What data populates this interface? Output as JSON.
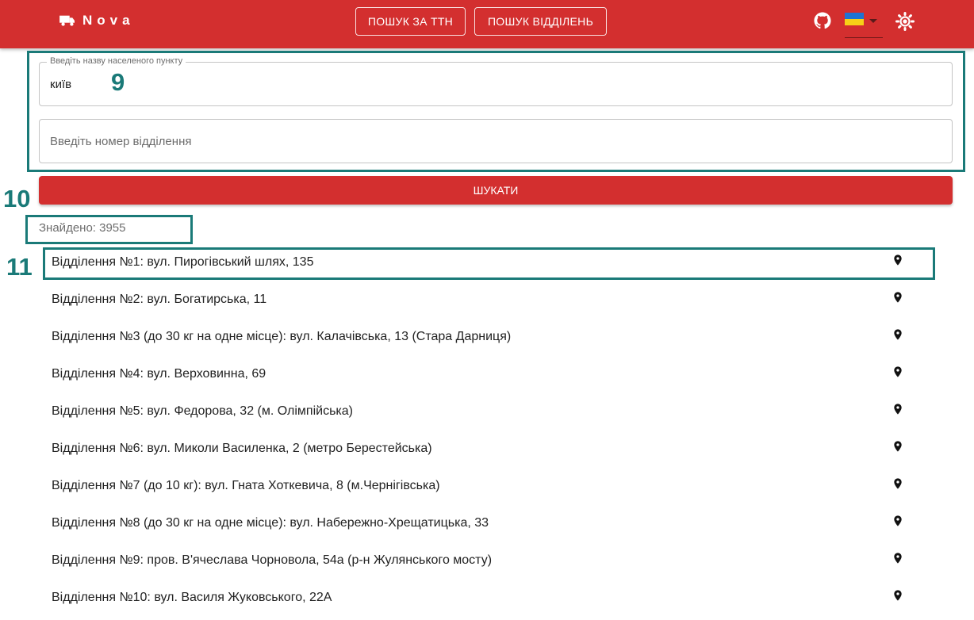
{
  "header": {
    "brand": "Nova",
    "nav": [
      "Пошук за ТТН",
      "Пошук відділень"
    ]
  },
  "annotations": {
    "form": "9",
    "search": "10",
    "first_result": "11"
  },
  "form": {
    "city": {
      "label": "Введіть назву населеного пункту",
      "value": "київ"
    },
    "branch": {
      "placeholder": "Введіть номер відділення"
    },
    "search_label": "Шукати"
  },
  "results": {
    "found_label": "Знайдено: 3955",
    "items": [
      "Відділення №1: вул. Пирогівський шлях, 135",
      "Відділення №2: вул. Богатирська, 11",
      "Відділення №3 (до 30 кг на одне місце): вул. Калачівська, 13 (Стара Дарниця)",
      "Відділення №4: вул. Верховинна, 69",
      "Відділення №5: вул. Федорова, 32 (м. Олімпійська)",
      "Відділення №6: вул. Миколи Василенка, 2 (метро Берестейська)",
      "Відділення №7 (до 10 кг): вул. Гната Хоткевича, 8 (м.Чернігівська)",
      "Відділення №8 (до 30 кг на одне місце): вул. Набережно-Хрещатицька, 33",
      "Відділення №9: пров. В'ячеслава Чорновола, 54а (р-н Жулянського мосту)",
      "Відділення №10: вул. Василя Жуковського, 22А"
    ]
  },
  "icons": {
    "brand": "truck-icon",
    "github": "github-icon",
    "language": "ukraine-flag-icon",
    "theme": "brightness-icon",
    "location": "map-pin-icon"
  },
  "colors": {
    "primary": "#d32f2f",
    "annotation": "#1a7a78"
  }
}
